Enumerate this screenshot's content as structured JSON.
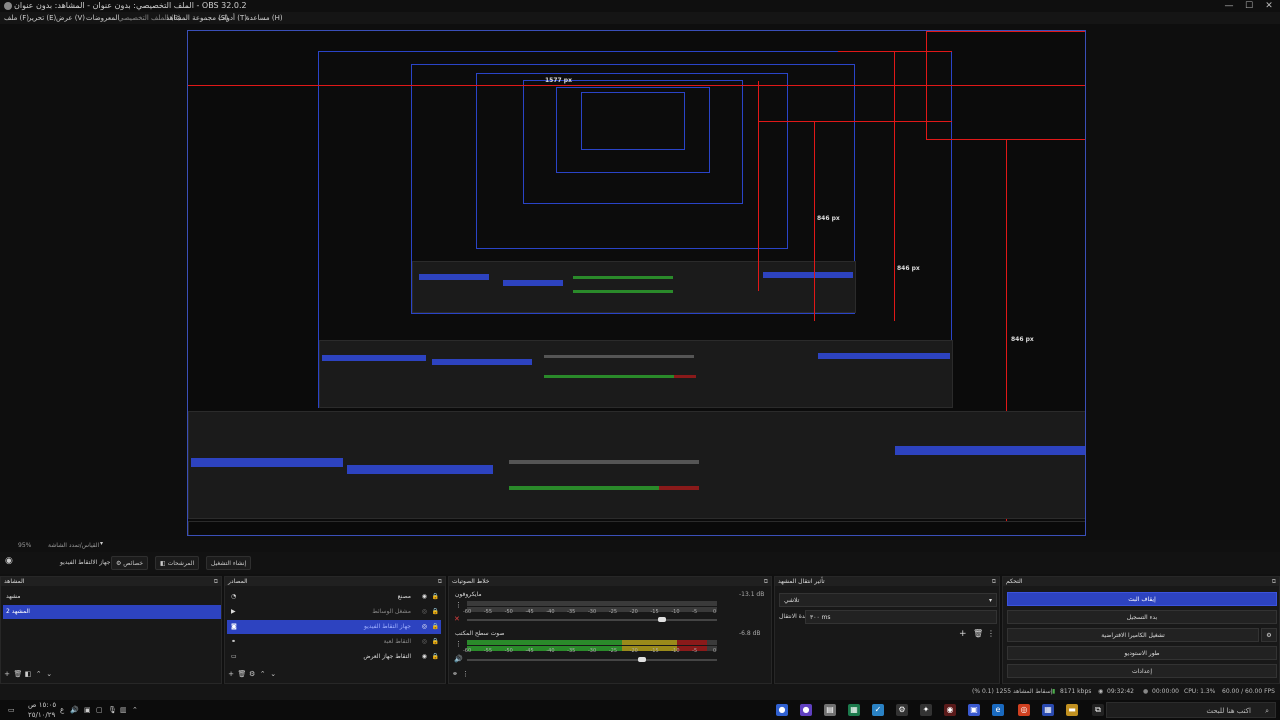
{
  "window": {
    "title": "الملف التخصيصي: بدون عنوان - المشاهد: بدون عنوان - OBS 32.0.2",
    "minimize": "—",
    "maximize": "☐",
    "close": "✕"
  },
  "menu": [
    {
      "label": "ملف (F)"
    },
    {
      "label": "تحرير (E)"
    },
    {
      "label": "عرض (V)"
    },
    {
      "label": "المعروضات"
    },
    {
      "label": "الملف التخصيصي (P)"
    },
    {
      "label": "مجموعة المشاهد (S)"
    },
    {
      "label": "أدوات (T)"
    },
    {
      "label": "مساعدة (H)"
    }
  ],
  "preview": {
    "labels": {
      "a": "846 px",
      "b": "846 px",
      "c": "846 px",
      "d": "1577 px"
    }
  },
  "zoom": {
    "value": "95%",
    "text": "القياس/تمدد الشاشة"
  },
  "scene_toolbar": {
    "studio_mode": "إنشاء التشغيل",
    "filters": "المرشحات",
    "properties": "خصائص",
    "device": "جهاز الالتقاط الفيديو"
  },
  "scenes": {
    "title": "المشاهد",
    "items": [
      {
        "label": "مشهد",
        "selected": false
      },
      {
        "label": "المشهد 2",
        "selected": true
      }
    ]
  },
  "sources": {
    "title": "المصادر",
    "items": [
      {
        "label": "مصنع",
        "icon": "◔",
        "selected": false
      },
      {
        "label": "مشغل الوسائط",
        "icon": "▶",
        "selected": false
      },
      {
        "label": "جهاز التقاط الفيديو",
        "icon": "◙",
        "selected": true
      },
      {
        "label": "التقاط لعبة",
        "icon": "⚭",
        "selected": false
      },
      {
        "label": "التقاط جهاز العرض",
        "icon": "▭",
        "selected": false
      }
    ]
  },
  "mixer": {
    "title": "خلاط الصوتيات",
    "channels": [
      {
        "name": "مايكروفون",
        "db": "-13.1 dB",
        "level": 0.0,
        "volume": 0.78
      },
      {
        "name": "صوت سطح المكتب",
        "db": "-6.8 dB",
        "level": 0.96,
        "volume": 0.7
      }
    ],
    "ticks": [
      "-60",
      "-55",
      "-50",
      "-45",
      "-40",
      "-35",
      "-30",
      "-25",
      "-20",
      "-15",
      "-10",
      "-5",
      "0"
    ]
  },
  "transitions": {
    "title": "تأثير انتقال المشهد",
    "selected": "تلاشي",
    "duration_label": "مدة الانتقال",
    "duration_value": "٣٠٠ ms"
  },
  "controls": {
    "title": "التحكم",
    "buttons": [
      {
        "label": "إيقاف البث",
        "primary": true
      },
      {
        "label": "بدء التسجيل",
        "primary": false
      },
      {
        "label": "تشغيل الكاميرا الافتراضية",
        "primary": false
      },
      {
        "label": "طور الاستوديو",
        "primary": false
      },
      {
        "label": "إعدادات",
        "primary": false
      }
    ]
  },
  "status": {
    "dropped": "إسقاط المشاهد 1255 (0.1 %)",
    "bitrate": "8171 kbps",
    "stream_time": "09:32:42",
    "rec_time": "00:00:00",
    "cpu": "CPU: 1.3%",
    "fps": "60.00 / 60.00 FPS"
  },
  "taskbar": {
    "search_placeholder": "اكتب هنا للبحث",
    "clock_time": "١٥:٠٥ ص",
    "clock_date": "٢٥/١٠/٢٩"
  },
  "colors": {
    "accent": "#2d43c0",
    "guide": "#e01818",
    "meter_green": "#2a8a2a",
    "meter_yellow": "#9a8a1a",
    "meter_red": "#8a1a1a"
  }
}
